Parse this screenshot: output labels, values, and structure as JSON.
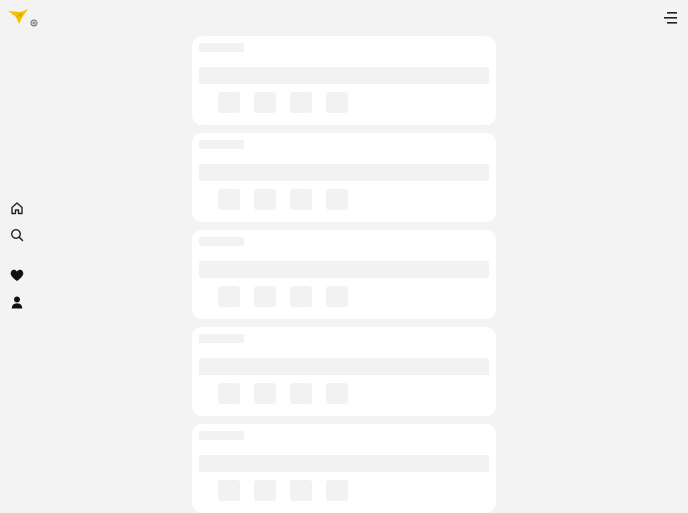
{
  "app": {
    "name": "",
    "brand_color": "#f5c400"
  },
  "header": {
    "logo_icon": "bird-logo-icon",
    "menu_icon": "menu-icon"
  },
  "sidebar": {
    "items": [
      {
        "name": "home",
        "icon": "home-icon"
      },
      {
        "name": "search",
        "icon": "search-icon"
      },
      {
        "name": "favorites",
        "icon": "heart-icon"
      },
      {
        "name": "profile",
        "icon": "user-icon"
      }
    ]
  },
  "feed": {
    "state": "loading",
    "skeleton_cards": 5,
    "skeleton_color": "#f2f2f2",
    "card_color": "#ffffff"
  }
}
